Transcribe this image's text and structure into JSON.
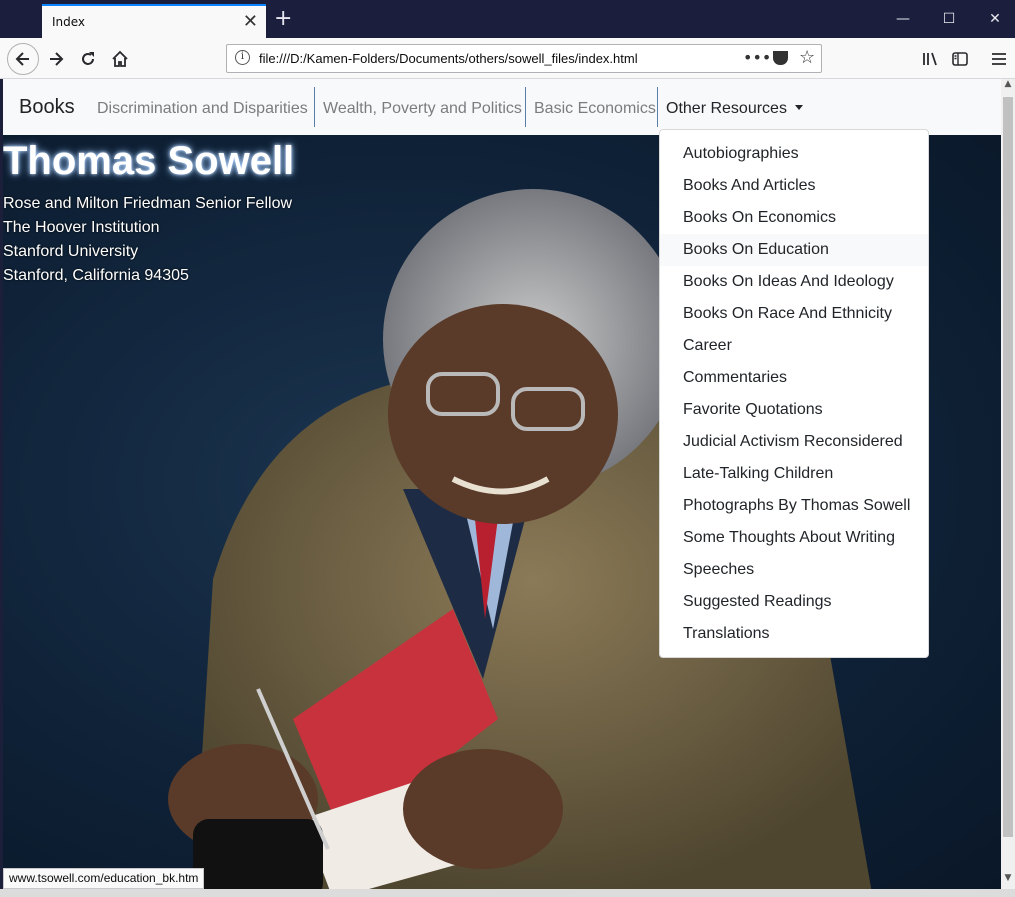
{
  "browser": {
    "tab_title": "Index",
    "tab_close": "✕",
    "new_tab": "+",
    "url": "file:///D:/Kamen-Folders/Documents/others/sowell_files/index.html",
    "url_more": "•••",
    "window_minimize": "—",
    "window_maximize": "☐",
    "window_close": "✕"
  },
  "navbar": {
    "brand": "Books",
    "links": [
      "Discrimination and Disparities",
      "Wealth, Poverty and Politics",
      "Basic Economics"
    ],
    "dropdown_label": "Other Resources"
  },
  "hero": {
    "name": "Thomas Sowell",
    "address": [
      "Rose and Milton Friedman Senior Fellow",
      "The Hoover Institution",
      "Stanford University",
      "Stanford, California 94305"
    ]
  },
  "dropdown": {
    "items": [
      "Autobiographies",
      "Books And Articles",
      "Books On Economics",
      "Books On Education",
      "Books On Ideas And Ideology",
      "Books On Race And Ethnicity",
      "Career",
      "Commentaries",
      "Favorite Quotations",
      "Judicial Activism Reconsidered",
      "Late-Talking Children",
      "Photographs By Thomas Sowell",
      "Some Thoughts About Writing",
      "Speeches",
      "Suggested Readings",
      "Translations"
    ],
    "hovered_item": "Books On Education"
  },
  "status_bar": {
    "link_url": "www.tsowell.com/education_bk.htm"
  },
  "colors": {
    "titlebar": "#1b1e3d",
    "accent": "#0a84ff",
    "hero_background": "#0f2238"
  }
}
